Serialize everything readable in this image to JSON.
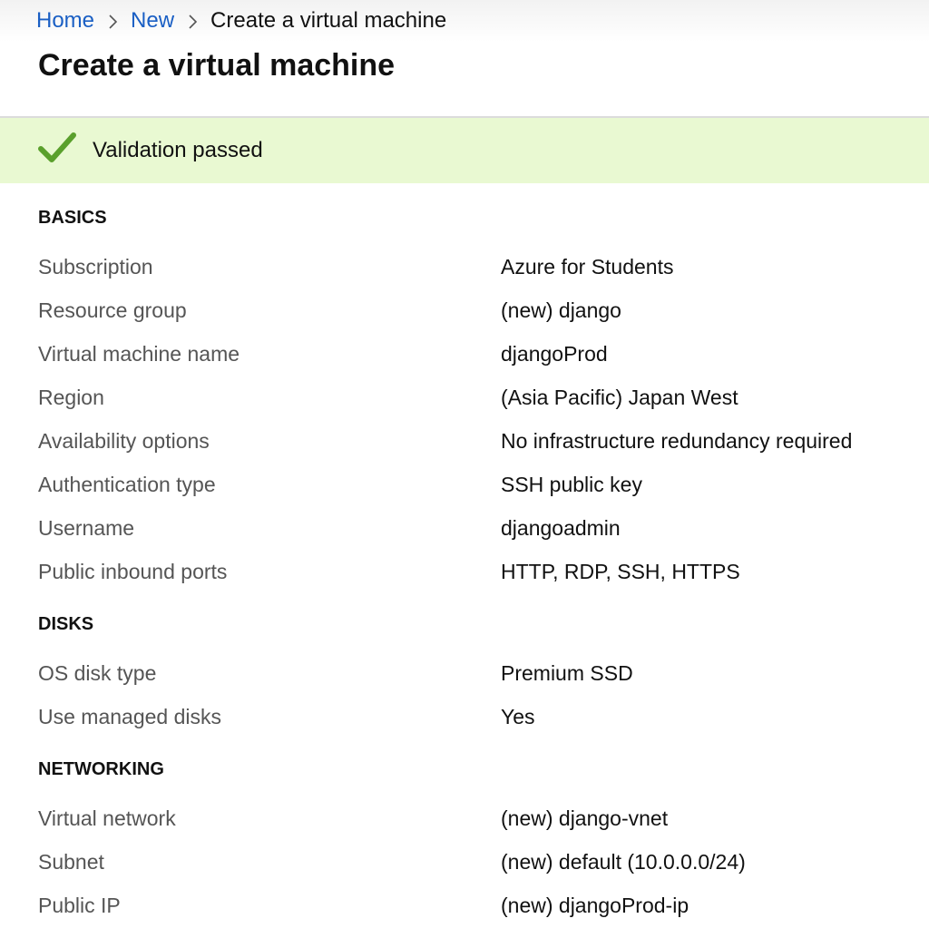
{
  "breadcrumb": {
    "home": "Home",
    "new": "New",
    "current": "Create a virtual machine"
  },
  "page_title": "Create a virtual machine",
  "validation": {
    "message": "Validation passed",
    "icon": "check-icon",
    "color": "#5aa02c"
  },
  "sections": {
    "basics": {
      "title": "BASICS",
      "rows": [
        {
          "label": "Subscription",
          "value": "Azure for Students"
        },
        {
          "label": "Resource group",
          "value": "(new) django"
        },
        {
          "label": "Virtual machine name",
          "value": "djangoProd"
        },
        {
          "label": "Region",
          "value": "(Asia Pacific) Japan West"
        },
        {
          "label": "Availability options",
          "value": "No infrastructure redundancy required"
        },
        {
          "label": "Authentication type",
          "value": "SSH public key"
        },
        {
          "label": "Username",
          "value": "djangoadmin"
        },
        {
          "label": "Public inbound ports",
          "value": "HTTP, RDP, SSH, HTTPS"
        }
      ]
    },
    "disks": {
      "title": "DISKS",
      "rows": [
        {
          "label": "OS disk type",
          "value": "Premium SSD"
        },
        {
          "label": "Use managed disks",
          "value": "Yes"
        }
      ]
    },
    "networking": {
      "title": "NETWORKING",
      "rows": [
        {
          "label": "Virtual network",
          "value": "(new) django-vnet"
        },
        {
          "label": "Subnet",
          "value": "(new) default (10.0.0.0/24)"
        },
        {
          "label": "Public IP",
          "value": "(new) djangoProd-ip"
        }
      ]
    }
  }
}
